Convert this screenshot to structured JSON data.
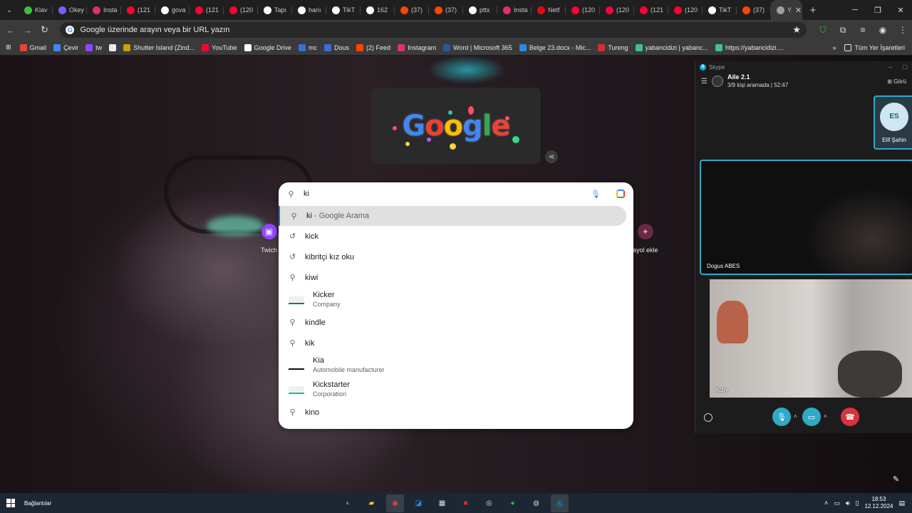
{
  "tabs": [
    {
      "label": "Klav",
      "icon": "power-icon",
      "color": "#3fbf3f"
    },
    {
      "label": "Okey",
      "icon": "okey-icon",
      "color": "#7b5cff"
    },
    {
      "label": "Insta",
      "icon": "instagram-icon",
      "color": "#e1306c"
    },
    {
      "label": "(121",
      "icon": "youtube-icon",
      "color": "#ff0033"
    },
    {
      "label": "gova",
      "icon": "google-icon",
      "color": "#ffffff"
    },
    {
      "label": "(121",
      "icon": "youtube-icon",
      "color": "#ff0033"
    },
    {
      "label": "(120",
      "icon": "youtube-icon",
      "color": "#ff0033"
    },
    {
      "label": "Tapı",
      "icon": "wikipedia-icon",
      "color": "#ffffff"
    },
    {
      "label": "hariı",
      "icon": "google-icon",
      "color": "#ffffff"
    },
    {
      "label": "TikT",
      "icon": "tiktok-icon",
      "color": "#ffffff"
    },
    {
      "label": "162",
      "icon": "google-icon",
      "color": "#ffffff"
    },
    {
      "label": "(37)",
      "icon": "reddit-icon",
      "color": "#ff4500"
    },
    {
      "label": "(37)",
      "icon": "reddit-icon",
      "color": "#ff4500"
    },
    {
      "label": "pttx",
      "icon": "google-icon",
      "color": "#ffffff"
    },
    {
      "label": "Insta",
      "icon": "instagram-icon",
      "color": "#e1306c"
    },
    {
      "label": "Netf",
      "icon": "netflix-icon",
      "color": "#e50914"
    },
    {
      "label": "(120",
      "icon": "youtube-icon",
      "color": "#ff0033"
    },
    {
      "label": "(120",
      "icon": "youtube-icon",
      "color": "#ff0033"
    },
    {
      "label": "(121",
      "icon": "youtube-icon",
      "color": "#ff0033"
    },
    {
      "label": "(120",
      "icon": "youtube-icon",
      "color": "#ff0033"
    },
    {
      "label": "TikT",
      "icon": "tiktok-icon",
      "color": "#ffffff"
    },
    {
      "label": "(37)",
      "icon": "reddit-icon",
      "color": "#ff4500"
    }
  ],
  "active_tab": {
    "label": "Y",
    "icon": "chrome-icon"
  },
  "toolbar": {
    "omnibox_text": "Google üzerinde arayın veya bir URL yazın"
  },
  "bookmarks": [
    {
      "label": "Gmail",
      "color": "#ea4335"
    },
    {
      "label": "Çevir",
      "color": "#4285f4"
    },
    {
      "label": "tw",
      "color": "#9146ff"
    },
    {
      "label": "",
      "color": "#e8eaed",
      "icon": "x-icon"
    },
    {
      "label": "Shutter Island (Zind...",
      "color": "#c8a200"
    },
    {
      "label": "YouTube",
      "color": "#ff0033"
    },
    {
      "label": "Google Drive",
      "color": "#ffffff"
    },
    {
      "label": "mc",
      "color": "#3b6fd8"
    },
    {
      "label": "Dous",
      "color": "#3b6fd8"
    },
    {
      "label": "(2) Feed",
      "color": "#ff4500"
    },
    {
      "label": "Instagram",
      "color": "#e1306c"
    },
    {
      "label": "Word | Microsoft 365",
      "color": "#2b579a"
    },
    {
      "label": "Belge 23.docx - Mic...",
      "color": "#2b8be0"
    },
    {
      "label": "Tureng",
      "color": "#d32f2f"
    },
    {
      "label": "yabancidizi | yabanc...",
      "color": "#3fbf9f"
    },
    {
      "label": "https://yabancidizi....",
      "color": "#3fbf9f"
    }
  ],
  "bookmarks_all": "Tüm Yer İşaretleri",
  "doodle": {
    "text": "Google"
  },
  "shortcuts": {
    "left_label": "Twich",
    "right_label": "ayol ekle"
  },
  "search": {
    "query": "ki",
    "suggestions": [
      {
        "type": "search",
        "text": "ki",
        "sub": " - Google Arama",
        "icon": "search-icon"
      },
      {
        "type": "history",
        "text": "kick",
        "icon": "history-icon"
      },
      {
        "type": "history",
        "text": "kibritçi kız oku",
        "icon": "history-icon"
      },
      {
        "type": "search",
        "text": "kiwi",
        "icon": "search-icon"
      },
      {
        "type": "entity",
        "text": "Kicker",
        "desc": "Company",
        "logo": "kicker-logo",
        "logo_color": "#1f7a3a"
      },
      {
        "type": "search",
        "text": "kindle",
        "icon": "search-icon"
      },
      {
        "type": "search",
        "text": "kik",
        "icon": "search-icon"
      },
      {
        "type": "entity",
        "text": "Kia",
        "desc": "Automobile manufacturer",
        "logo": "kia-logo",
        "logo_color": "#05141f"
      },
      {
        "type": "entity",
        "text": "Kickstarter",
        "desc": "Corporation",
        "logo": "kickstarter-logo",
        "logo_color": "#05ce78"
      },
      {
        "type": "search",
        "text": "kino",
        "icon": "search-icon"
      }
    ]
  },
  "skype": {
    "app_title": "Skype",
    "group_name": "Aile 2.1",
    "group_info": "3/9 kişi aramada | 52:47",
    "view_label": "Görü",
    "mini_initials": "ES",
    "mini_name": "Elif Şahin",
    "video1_name": "Dogus ABES",
    "video2_name": "Kızıy"
  },
  "taskbar": {
    "label": "Bağlantılar",
    "time": "18:53",
    "date": "12.12.2024"
  },
  "colors": {
    "skype_blue": "#2fa9c5",
    "end_call": "#d8333e",
    "accent": "#1a73e8"
  }
}
